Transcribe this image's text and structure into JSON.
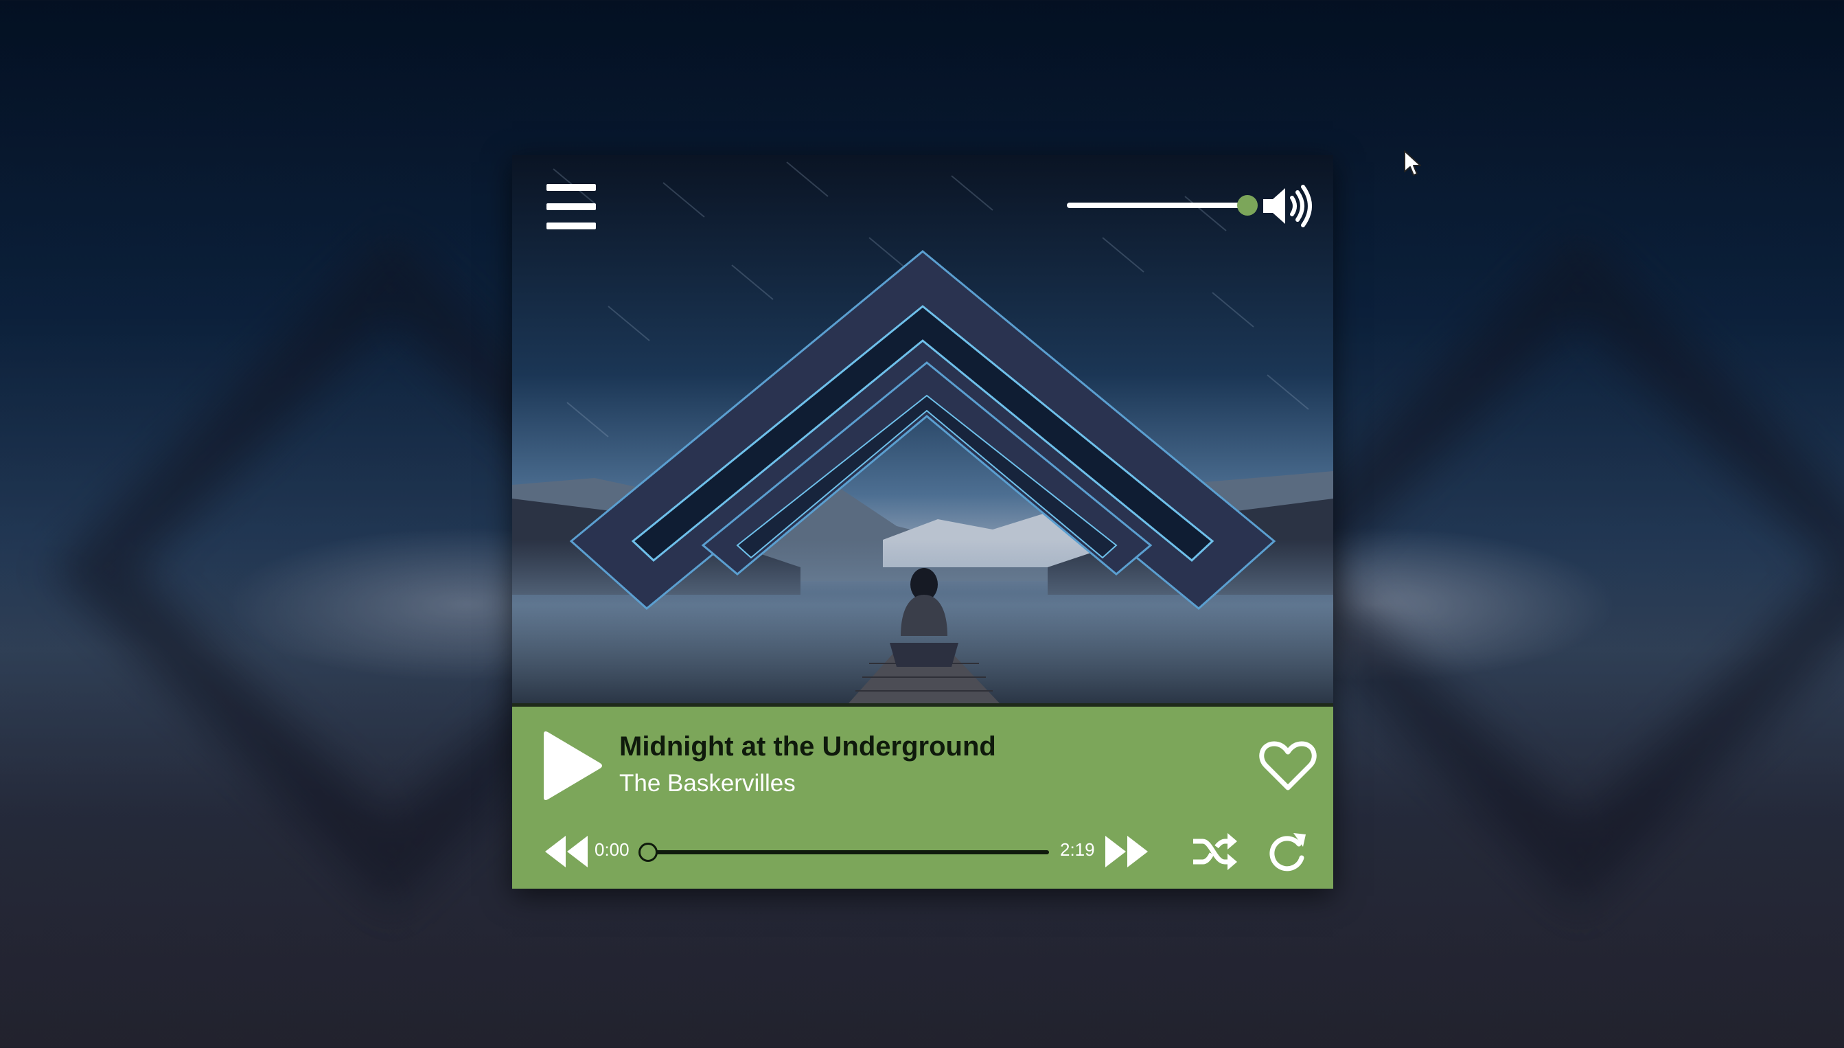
{
  "colors": {
    "accent": "#7ca65a",
    "control_dark": "#0f1a0c",
    "icon_white": "#ffffff"
  },
  "menu": {
    "icon": "hamburger-menu-icon"
  },
  "volume": {
    "level": 0.95,
    "icon": "speaker-volume-icon"
  },
  "track": {
    "title": "Midnight at the Underground",
    "artist": "The Baskervilles"
  },
  "playback": {
    "current_time": "0:00",
    "duration": "2:19",
    "progress": 0.0
  },
  "icons": {
    "play": "play-icon",
    "like": "heart-icon",
    "rewind": "rewind-icon",
    "forward": "fast-forward-icon",
    "shuffle": "shuffle-icon",
    "repeat": "repeat-icon"
  }
}
